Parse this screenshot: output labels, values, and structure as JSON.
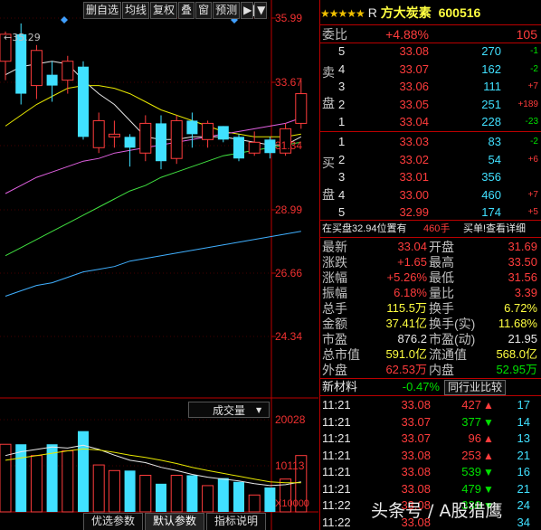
{
  "toolbar": {
    "buttons": [
      "删自选",
      "均线",
      "复权",
      "叠",
      "窗",
      "预测",
      "▶|",
      "▼"
    ]
  },
  "chart": {
    "high_label": "35.29",
    "price_axis": [
      "35.99",
      "33.67",
      "31.34",
      "28.99",
      "26.66",
      "24.34"
    ],
    "volume_axis": [
      "20028",
      "10113",
      "X10000"
    ],
    "volume_title": "成交量",
    "bottom_tabs": [
      "优选参数",
      "默认参数",
      "指标说明"
    ]
  },
  "chart_data": {
    "type": "candlestick",
    "price_range": [
      21.8,
      36.2
    ],
    "candles": [
      {
        "o": 34.2,
        "h": 35.3,
        "l": 33.5,
        "c": 35.2
      },
      {
        "o": 35.2,
        "h": 35.6,
        "l": 32.6,
        "c": 33.0
      },
      {
        "o": 33.3,
        "h": 34.8,
        "l": 32.8,
        "c": 34.6
      },
      {
        "o": 33.7,
        "h": 34.2,
        "l": 32.7,
        "c": 33.3
      },
      {
        "o": 33.5,
        "h": 34.4,
        "l": 33.0,
        "c": 34.2
      },
      {
        "o": 34.0,
        "h": 34.2,
        "l": 31.3,
        "c": 31.4
      },
      {
        "o": 31.0,
        "h": 32.3,
        "l": 30.8,
        "c": 32.0
      },
      {
        "o": 31.4,
        "h": 32.0,
        "l": 31.0,
        "c": 31.5
      },
      {
        "o": 31.4,
        "h": 31.5,
        "l": 30.3,
        "c": 31.0
      },
      {
        "o": 30.8,
        "h": 32.2,
        "l": 30.5,
        "c": 31.9
      },
      {
        "o": 31.9,
        "h": 32.2,
        "l": 30.2,
        "c": 30.5
      },
      {
        "o": 30.6,
        "h": 32.2,
        "l": 30.4,
        "c": 32.0
      },
      {
        "o": 32.0,
        "h": 32.3,
        "l": 31.0,
        "c": 31.5
      },
      {
        "o": 31.3,
        "h": 32.0,
        "l": 31.0,
        "c": 31.9
      },
      {
        "o": 31.8,
        "h": 31.8,
        "l": 31.2,
        "c": 31.3
      },
      {
        "o": 31.4,
        "h": 31.5,
        "l": 30.5,
        "c": 30.6
      },
      {
        "o": 30.8,
        "h": 31.6,
        "l": 30.7,
        "c": 31.2
      },
      {
        "o": 31.3,
        "h": 31.4,
        "l": 30.6,
        "c": 30.8
      },
      {
        "o": 30.8,
        "h": 31.9,
        "l": 30.7,
        "c": 31.7
      },
      {
        "o": 31.9,
        "h": 33.5,
        "l": 31.7,
        "c": 33.0
      }
    ],
    "ma_lines": [
      {
        "name": "MA5",
        "color": "#e8e8e8",
        "values": [
          33.7,
          34.0,
          34.1,
          34.2,
          34.1,
          33.5,
          33.0,
          32.6,
          32.0,
          31.4,
          31.3,
          31.3,
          31.4,
          31.4,
          31.4,
          31.3,
          31.2,
          31.1,
          31.1,
          31.4
        ]
      },
      {
        "name": "MA10",
        "color": "#e8e800",
        "values": [
          31.8,
          32.2,
          32.6,
          32.9,
          33.2,
          33.3,
          33.3,
          33.2,
          33.0,
          32.7,
          32.4,
          32.2,
          32.0,
          31.8,
          31.6,
          31.5,
          31.4,
          31.4,
          31.4,
          31.5
        ]
      },
      {
        "name": "MA20",
        "color": "#e060e0",
        "values": [
          29.3,
          29.6,
          29.9,
          30.1,
          30.3,
          30.5,
          30.6,
          30.8,
          30.9,
          31.0,
          31.1,
          31.2,
          31.3,
          31.4,
          31.5,
          31.6,
          31.7,
          31.8,
          31.9,
          32.1
        ]
      },
      {
        "name": "MA30",
        "color": "#40e040",
        "values": [
          27.0,
          27.3,
          27.6,
          27.9,
          28.2,
          28.5,
          28.8,
          29.1,
          29.4,
          29.6,
          29.9,
          30.1,
          30.3,
          30.5,
          30.7,
          30.8,
          30.9,
          31.0,
          31.1,
          31.2
        ]
      },
      {
        "name": "MA60",
        "color": "#40b0ff",
        "values": [
          25.5,
          25.7,
          25.9,
          26.0,
          26.2,
          26.4,
          26.5,
          26.6,
          26.8,
          26.9,
          27.0,
          27.1,
          27.2,
          27.3,
          27.4,
          27.5,
          27.6,
          27.7,
          27.8,
          27.9
        ]
      }
    ],
    "volume": [
      1.44,
      1.44,
      1.2,
      1.44,
      1.3,
      1.72,
      1.0,
      0.88,
      0.88,
      0.78,
      0.6,
      0.78,
      0.78,
      0.56,
      0.72,
      0.64,
      0.36,
      0.52,
      0.7,
      1.2
    ],
    "volume_ma": [
      {
        "color": "#e8e8e8",
        "values": [
          1.2,
          1.28,
          1.33,
          1.38,
          1.36,
          1.42,
          1.33,
          1.21,
          1.1,
          1.05,
          0.95,
          0.88,
          0.8,
          0.74,
          0.7,
          0.66,
          0.6,
          0.56,
          0.58,
          0.64
        ]
      },
      {
        "color": "#e8e800",
        "values": [
          1.1,
          1.15,
          1.2,
          1.25,
          1.3,
          1.34,
          1.32,
          1.27,
          1.21,
          1.16,
          1.1,
          1.03,
          0.95,
          0.88,
          0.82,
          0.76,
          0.7,
          0.64,
          0.62,
          0.62
        ]
      }
    ],
    "volume_range": [
      0,
      2.0028
    ]
  },
  "quote": {
    "title_stars": "★★★★★",
    "title_flag": "R",
    "name": "方大炭素",
    "code": "600516",
    "webi_label": "委比",
    "webi_pct": "+4.88%",
    "webi_diff": "105",
    "sell_label": [
      "卖",
      "盘"
    ],
    "buy_label": [
      "买",
      "盘"
    ],
    "asks": [
      {
        "lvl": "5",
        "price": "33.08",
        "vol": "270",
        "chg": "-1"
      },
      {
        "lvl": "4",
        "price": "33.07",
        "vol": "162",
        "chg": "-2"
      },
      {
        "lvl": "3",
        "price": "33.06",
        "vol": "111",
        "chg": "+7"
      },
      {
        "lvl": "2",
        "price": "33.05",
        "vol": "251",
        "chg": "+189"
      },
      {
        "lvl": "1",
        "price": "33.04",
        "vol": "228",
        "chg": "-23"
      }
    ],
    "bids": [
      {
        "lvl": "1",
        "price": "33.03",
        "vol": "83",
        "chg": "-2"
      },
      {
        "lvl": "2",
        "price": "33.02",
        "vol": "54",
        "chg": "+6"
      },
      {
        "lvl": "3",
        "price": "33.01",
        "vol": "356",
        "chg": ""
      },
      {
        "lvl": "4",
        "price": "33.00",
        "vol": "460",
        "chg": "+7"
      },
      {
        "lvl": "5",
        "price": "32.99",
        "vol": "174",
        "chg": "+5"
      }
    ],
    "notice_text": "在买盘32.94位置有",
    "notice_vol": "460手",
    "notice_link": "买单!查看详细",
    "info_left": [
      {
        "label": "最新",
        "value": "33.04",
        "color": "red"
      },
      {
        "label": "涨跌",
        "value": "+1.65",
        "color": "red"
      },
      {
        "label": "涨幅",
        "value": "+5.26%",
        "color": "red"
      },
      {
        "label": "振幅",
        "value": "6.18%",
        "color": "red"
      },
      {
        "label": "总手",
        "value": "115.5万",
        "color": "yellow"
      },
      {
        "label": "金额",
        "value": "37.41亿",
        "color": "yellow"
      },
      {
        "label": "市盈",
        "value": "876.2",
        "color": "white"
      },
      {
        "label": "总市值",
        "value": "591.0亿",
        "color": "yellow"
      },
      {
        "label": "外盘",
        "value": "62.53万",
        "color": "red"
      }
    ],
    "info_right": [
      {
        "label": "开盘",
        "value": "31.69",
        "color": "red"
      },
      {
        "label": "最高",
        "value": "33.50",
        "color": "red"
      },
      {
        "label": "最低",
        "value": "31.56",
        "color": "red"
      },
      {
        "label": "量比",
        "value": "3.39",
        "color": "red"
      },
      {
        "label": "换手",
        "value": "6.72%",
        "color": "yellow"
      },
      {
        "label": "换手(实)",
        "value": "11.68%",
        "color": "yellow"
      },
      {
        "label": "市盈(动)",
        "value": "21.95",
        "color": "white"
      },
      {
        "label": "流通值",
        "value": "568.0亿",
        "color": "yellow"
      },
      {
        "label": "内盘",
        "value": "52.95万",
        "color": "green"
      }
    ],
    "sector_name": "新材料",
    "sector_pct": "-0.47%",
    "peer_button": "同行业比较",
    "ticks": [
      {
        "time": "11:21",
        "price": "33.08",
        "vol": "427",
        "dir": "up",
        "num": "17"
      },
      {
        "time": "11:21",
        "price": "33.07",
        "vol": "377",
        "dir": "down",
        "num": "14"
      },
      {
        "time": "11:21",
        "price": "33.07",
        "vol": "96",
        "dir": "up",
        "num": "13"
      },
      {
        "time": "11:21",
        "price": "33.08",
        "vol": "253",
        "dir": "up",
        "num": "21"
      },
      {
        "time": "11:21",
        "price": "33.08",
        "vol": "539",
        "dir": "down",
        "num": "16"
      },
      {
        "time": "11:21",
        "price": "33.08",
        "vol": "479",
        "dir": "down",
        "num": "21"
      },
      {
        "time": "11:22",
        "price": "33.08",
        "vol": "330",
        "dir": "down",
        "num": "24"
      },
      {
        "time": "11:22",
        "price": "33.08",
        "vol": "",
        "dir": "",
        "num": "34"
      }
    ]
  },
  "watermark": "头条号 / A股猎鹰"
}
